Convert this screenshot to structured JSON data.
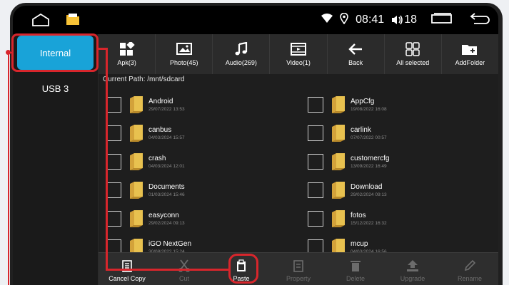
{
  "status_bar": {
    "time": "08:41",
    "volume": "18"
  },
  "sidebar": {
    "items": [
      {
        "label": "Internal",
        "active": true
      },
      {
        "label": "USB 3",
        "active": false
      }
    ]
  },
  "toolbar": [
    {
      "label": "Apk(3)",
      "icon": "apk-icon"
    },
    {
      "label": "Photo(45)",
      "icon": "photo-icon"
    },
    {
      "label": "Audio(269)",
      "icon": "audio-icon"
    },
    {
      "label": "Video(1)",
      "icon": "video-icon"
    },
    {
      "label": "Back",
      "icon": "back-arrow-icon"
    },
    {
      "label": "All selected",
      "icon": "grid-icon"
    },
    {
      "label": "AddFolder",
      "icon": "add-folder-icon"
    }
  ],
  "path": "Current Path: /mnt/sdcard",
  "files": [
    {
      "name": "Android",
      "date": "29/07/2022 13:53"
    },
    {
      "name": "AppCfg",
      "date": "19/08/2022 16:08"
    },
    {
      "name": "canbus",
      "date": "04/03/2024 15:57"
    },
    {
      "name": "carlink",
      "date": "07/07/2022 00:57"
    },
    {
      "name": "crash",
      "date": "04/03/2024 12:01"
    },
    {
      "name": "customercfg",
      "date": "13/09/2022 16:49"
    },
    {
      "name": "Documents",
      "date": "01/03/2024 15:46"
    },
    {
      "name": "Download",
      "date": "29/02/2024 09:13"
    },
    {
      "name": "easyconn",
      "date": "29/02/2024 09:13"
    },
    {
      "name": "fotos",
      "date": "15/12/2022 16:32"
    },
    {
      "name": "iGO NextGen",
      "date": "30/08/2022 15:24"
    },
    {
      "name": "mcup",
      "date": "04/03/2024 16:56"
    }
  ],
  "bottom_bar": [
    {
      "label": "Cancel Copy",
      "enabled": true
    },
    {
      "label": "Cut",
      "enabled": false
    },
    {
      "label": "Paste",
      "enabled": true
    },
    {
      "label": "Property",
      "enabled": false
    },
    {
      "label": "Delete",
      "enabled": false
    },
    {
      "label": "Upgrade",
      "enabled": false
    },
    {
      "label": "Rename",
      "enabled": false
    }
  ],
  "colors": {
    "accent": "#19a3d8",
    "highlight": "#d8262c",
    "folder": "#e8c14f"
  }
}
